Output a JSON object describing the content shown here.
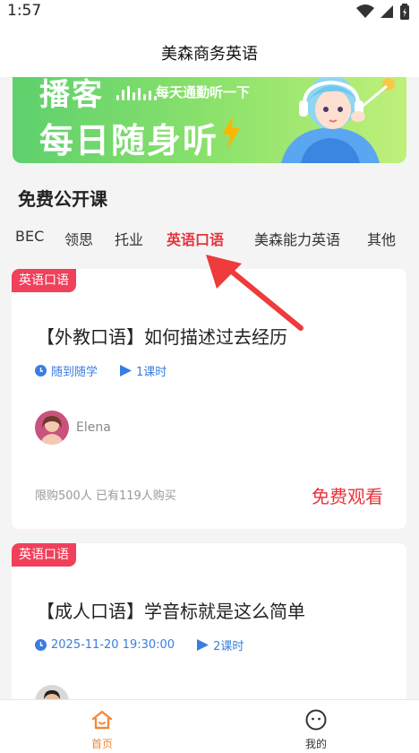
{
  "status_bar": {
    "time": "1:57"
  },
  "header": {
    "title": "美森商务英语"
  },
  "banner": {
    "line1": "播客",
    "line2": "每日随身听",
    "tagline": "每天通勤听一下"
  },
  "section": {
    "title": "免费公开课"
  },
  "tabs": [
    {
      "label": "BEC",
      "active": false
    },
    {
      "label": "领思",
      "active": false
    },
    {
      "label": "托业",
      "active": false
    },
    {
      "label": "英语口语",
      "active": true
    },
    {
      "label": "美森能力英语",
      "active": false
    },
    {
      "label": "其他",
      "active": false
    }
  ],
  "courses": [
    {
      "badge": "英语口语",
      "title": "【外教口语】如何描述过去经历",
      "schedule": "随到随学",
      "lessons": "1课时",
      "teacher": "Elena",
      "limit": "限购500人 已有119人购买",
      "action": "免费观看"
    },
    {
      "badge": "英语口语",
      "title": "【成人口语】学音标就是这么简单",
      "schedule": "2025-11-20 19:30:00",
      "lessons": "2课时"
    }
  ],
  "bottom_nav": [
    {
      "label": "首页",
      "icon": "home-icon",
      "active": true
    },
    {
      "label": "我的",
      "icon": "profile-icon",
      "active": false
    }
  ],
  "colors": {
    "accent": "#e8323c",
    "badge": "#f0405a",
    "meta": "#3a7de0",
    "nav_active": "#f08a3c"
  }
}
